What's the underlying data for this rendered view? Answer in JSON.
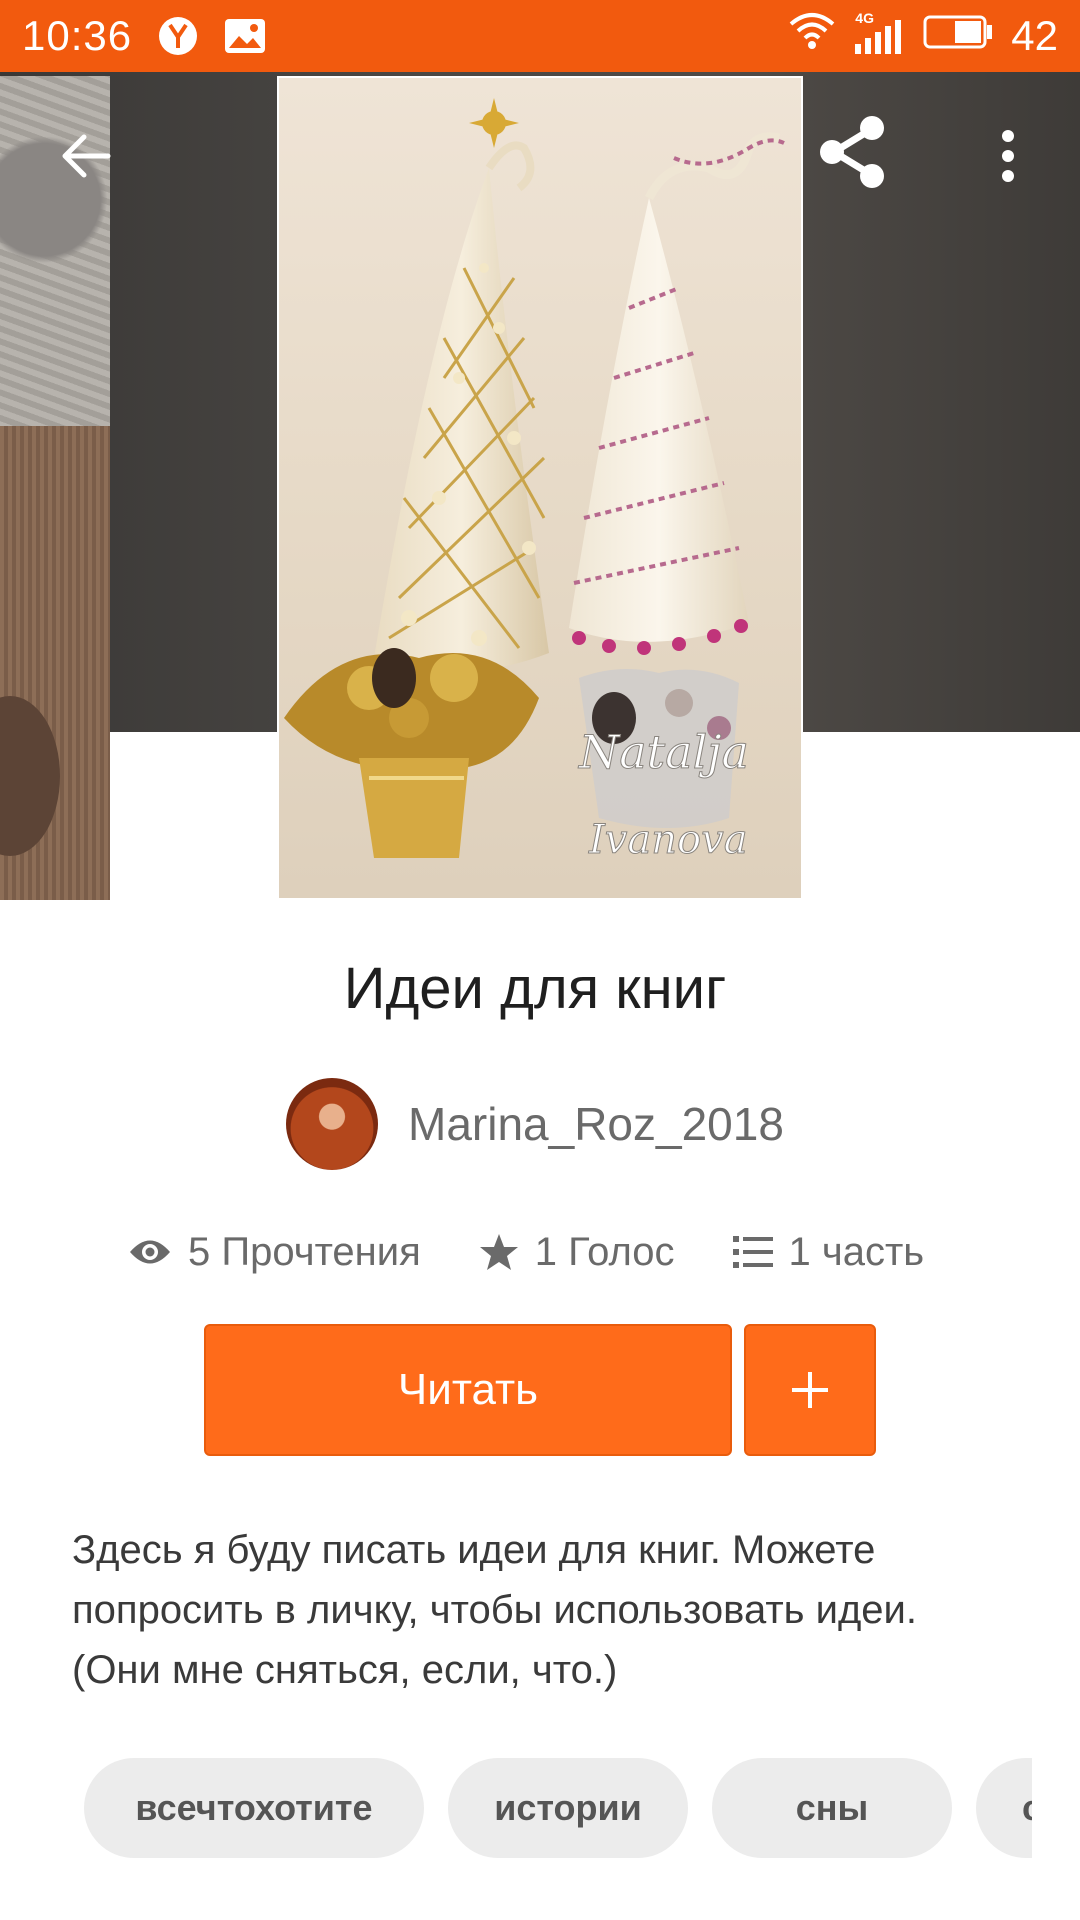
{
  "status_bar": {
    "time": "10:36",
    "network": "4G",
    "battery": "42",
    "icons": [
      "yandex-icon",
      "image-notification-icon",
      "wifi-icon",
      "signal-icon",
      "battery-icon"
    ]
  },
  "top_bar": {
    "back_icon": "arrow-left-icon",
    "share_icon": "share-icon",
    "more_icon": "more-vertical-icon"
  },
  "cover": {
    "watermark_line1": "Natalja",
    "watermark_line2": "Ivanova"
  },
  "story": {
    "title": "Идеи для книг",
    "author": "Marina_Roz_2018",
    "stats": {
      "reads": "5 Прочтения",
      "votes": "1 Голос",
      "parts": "1 часть"
    },
    "read_label": "Читать",
    "add_label": "+",
    "description": "Здесь я буду писать идеи для книг. Можете попросить в личку, чтобы использовать идеи. (Они мне сняться, если, что.)",
    "tags": [
      "всечтохотите",
      "истории",
      "сны",
      "с"
    ]
  },
  "colors": {
    "accent": "#ff6b1a",
    "status_bar": "#f25a0e",
    "tag_bg": "#ececec"
  }
}
